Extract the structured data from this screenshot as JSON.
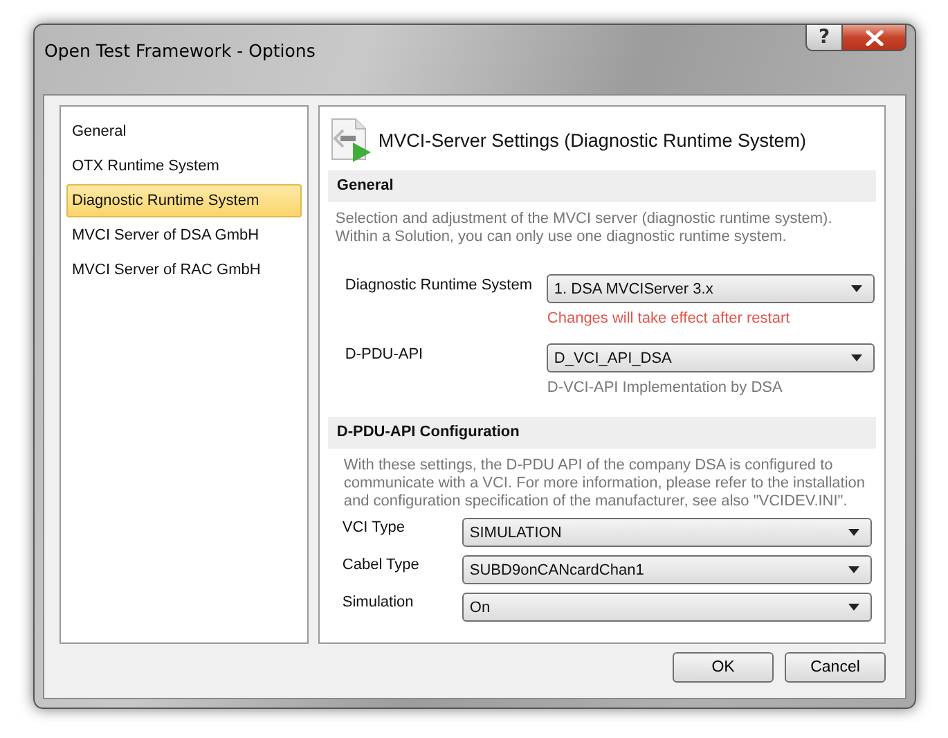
{
  "window": {
    "title": "Open Test Framework - Options",
    "help_button": "?"
  },
  "sidebar": {
    "items": [
      {
        "label": "General",
        "selected": false
      },
      {
        "label": "OTX Runtime System",
        "selected": false
      },
      {
        "label": "Diagnostic Runtime System",
        "selected": true
      },
      {
        "label": "MVCI Server of DSA GmbH",
        "selected": false
      },
      {
        "label": "MVCI Server of RAC GmbH",
        "selected": false
      }
    ]
  },
  "panel": {
    "title": "MVCI-Server Settings (Diagnostic Runtime System)",
    "sections": [
      {
        "heading": "General",
        "description": "Selection and adjustment of the MVCI server (diagnostic runtime system). Within a Solution, you can only use one diagnostic runtime system.",
        "fields": [
          {
            "label": "Diagnostic Runtime System",
            "value": "1. DSA MVCIServer 3.x",
            "note": {
              "text": "Changes will take effect after restart",
              "kind": "warning"
            }
          },
          {
            "label": "D-PDU-API",
            "value": "D_VCI_API_DSA",
            "note": {
              "text": "D-VCI-API Implementation by DSA",
              "kind": "info"
            }
          }
        ]
      },
      {
        "heading": "D-PDU-API Configuration",
        "description": "With these settings, the D-PDU API of the company DSA is configured to communicate with a VCI. For more information, please refer to the installation and configuration specification of the manufacturer, see also \"VCIDEV.INI\".",
        "fields": [
          {
            "label": "VCI Type",
            "value": "SIMULATION"
          },
          {
            "label": "Cabel Type",
            "value": "SUBD9onCANcardChan1"
          },
          {
            "label": "Simulation",
            "value": "On"
          }
        ]
      }
    ]
  },
  "buttons": [
    "OK",
    "Cancel"
  ]
}
